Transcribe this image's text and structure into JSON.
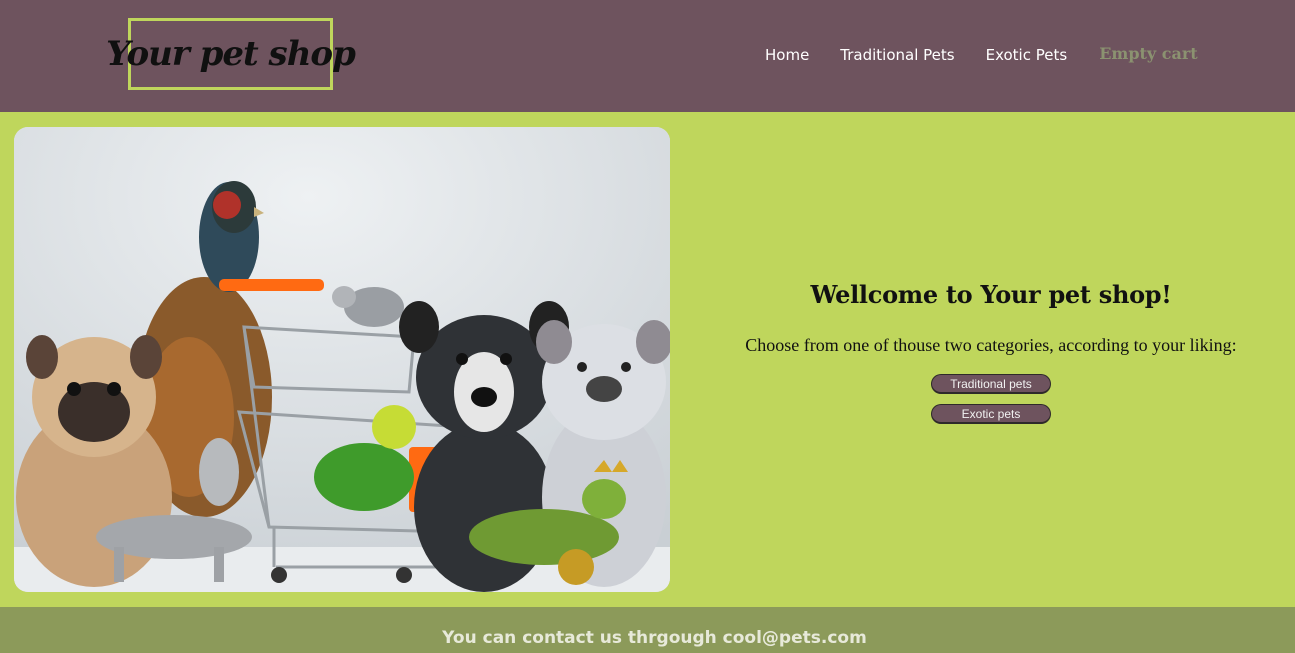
{
  "header": {
    "logo_text": "Your pet shop",
    "nav": {
      "home": "Home",
      "traditional": "Traditional Pets",
      "exotic": "Exotic Pets",
      "cart": "Empty cart"
    }
  },
  "hero": {
    "image_description_icon": "pet-figurines-with-shopping-cart-image"
  },
  "welcome": {
    "title": "Wellcome to Your pet shop!",
    "subtitle": "Choose from one of thouse two categories, according to your liking:",
    "buttons": {
      "traditional": "Traditional pets",
      "exotic": "Exotic pets"
    }
  },
  "footer": {
    "contact": "You can contact us thrgough cool@pets.com"
  },
  "colors": {
    "header_bg": "#6e535e",
    "page_bg": "#bfd65c",
    "footer_bg": "#8c9a5a",
    "logo_border": "#bfd65c",
    "button_bg": "#6e535e"
  }
}
